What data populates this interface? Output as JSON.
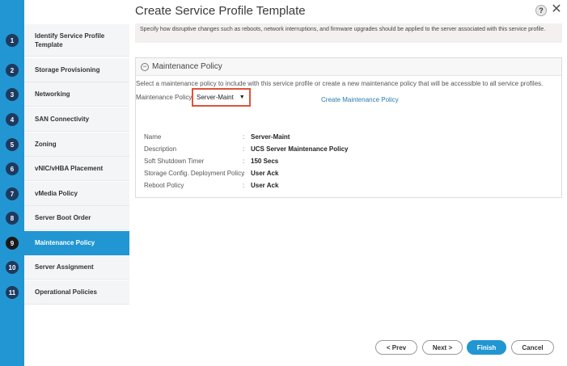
{
  "wizard": {
    "title": "Create Service Profile Template",
    "help": "?",
    "close": "✕",
    "steps": [
      {
        "num": "1",
        "label": "Identify Service Profile Template"
      },
      {
        "num": "2",
        "label": "Storage Provisioning"
      },
      {
        "num": "3",
        "label": "Networking"
      },
      {
        "num": "4",
        "label": "SAN Connectivity"
      },
      {
        "num": "5",
        "label": "Zoning"
      },
      {
        "num": "6",
        "label": "vNIC/vHBA Placement"
      },
      {
        "num": "7",
        "label": "vMedia Policy"
      },
      {
        "num": "8",
        "label": "Server Boot Order"
      },
      {
        "num": "9",
        "label": "Maintenance Policy"
      },
      {
        "num": "10",
        "label": "Server Assignment"
      },
      {
        "num": "11",
        "label": "Operational Policies"
      }
    ],
    "active_step": "9"
  },
  "warning": "Specify how disruptive changes such as reboots, network interruptions, and firmware upgrades should be applied to the server associated with this service profile.",
  "policy": {
    "section_title": "Maintenance Policy",
    "instructions": "Select a maintenance policy to include with this service profile or create a new maintenance policy that will be accessible to all service profiles.",
    "field_label": "Maintenance Policy:",
    "selected": "Server-Maint",
    "create_link": "Create Maintenance Policy",
    "details": [
      {
        "label": "Name",
        "value": "Server-Maint"
      },
      {
        "label": "Description",
        "value": "UCS Server Maintenance Policy"
      },
      {
        "label": "Soft Shutdown Timer",
        "value": "150 Secs"
      },
      {
        "label": "Storage Config. Deployment Policy",
        "value": "User Ack"
      },
      {
        "label": "Reboot Policy",
        "value": "User Ack"
      }
    ]
  },
  "buttons": {
    "prev": "< Prev",
    "next": "Next >",
    "finish": "Finish",
    "cancel": "Cancel"
  },
  "colors": {
    "accent": "#2196d3",
    "highlight_border": "#e0523a",
    "step_badge": "#1e3a5f"
  }
}
